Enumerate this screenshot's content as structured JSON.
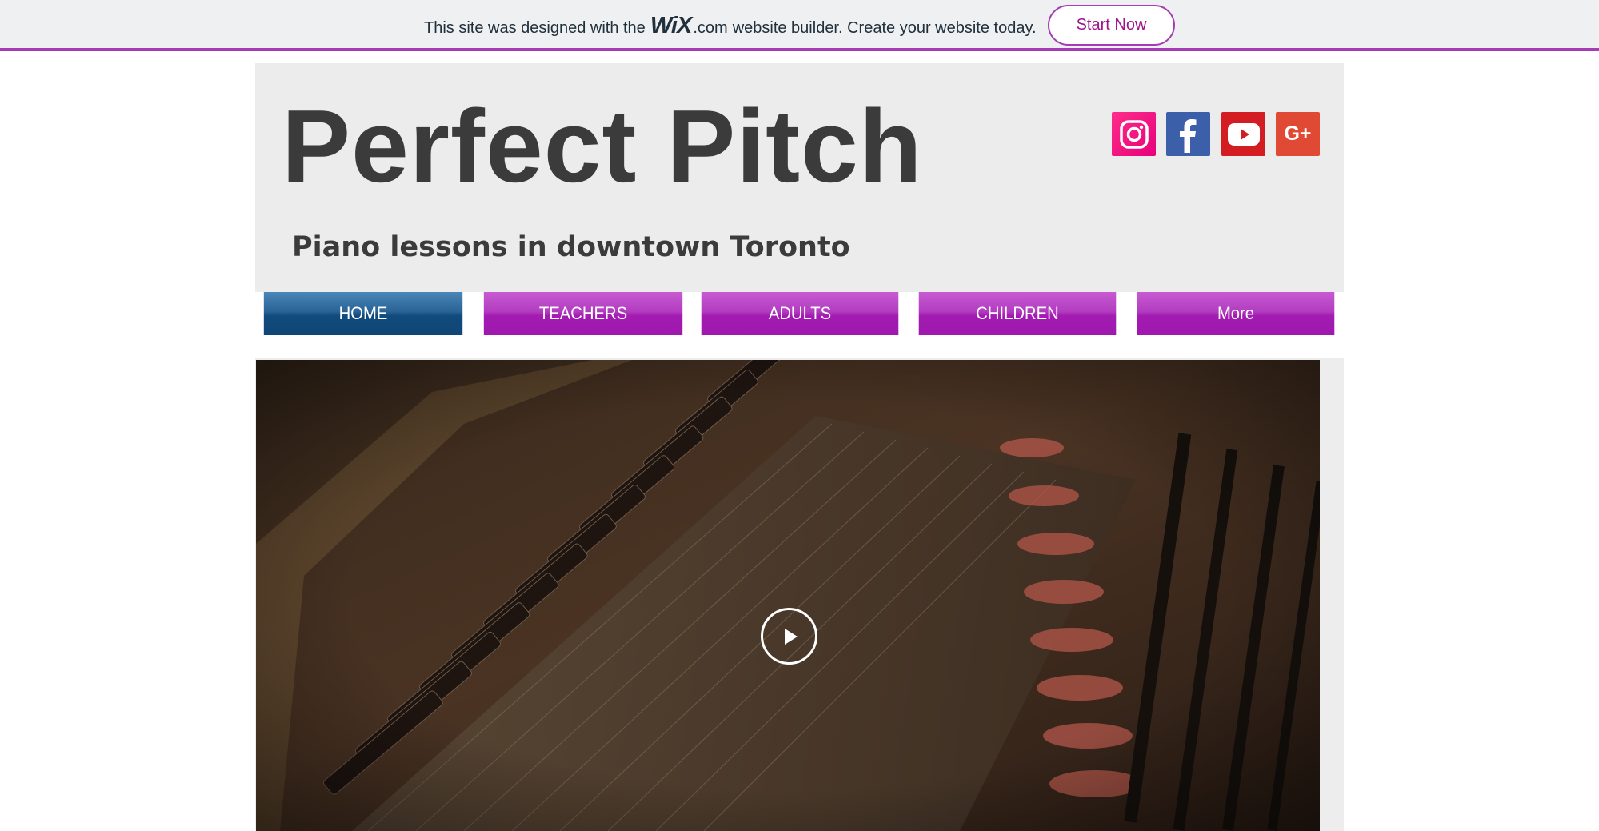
{
  "banner": {
    "text_before": "This site was designed with the",
    "logo_text": "WiX",
    "text_after": ".com",
    "text_rest": "website builder. Create your website today.",
    "cta_label": "Start Now",
    "accent_color": "#a43cb3"
  },
  "header": {
    "title": "Perfect Pitch",
    "tagline": "Piano lessons in downtown Toronto"
  },
  "social": [
    {
      "name": "instagram",
      "icon": "instagram-icon",
      "color": "#f5157c"
    },
    {
      "name": "facebook",
      "icon": "facebook-icon",
      "color": "#3b5fa8"
    },
    {
      "name": "youtube",
      "icon": "youtube-icon",
      "color": "#d31d23"
    },
    {
      "name": "google-plus",
      "icon": "google-plus-icon",
      "label": "G+",
      "color": "#e04a35"
    }
  ],
  "nav": {
    "items": [
      {
        "label": "HOME",
        "active": true
      },
      {
        "label": "TEACHERS",
        "active": false
      },
      {
        "label": "ADULTS",
        "active": false
      },
      {
        "label": "CHILDREN",
        "active": false
      },
      {
        "label": "More",
        "active": false
      }
    ],
    "active_color": "#1a5a8f",
    "item_color": "#a81fb6"
  },
  "video": {
    "play_icon": "play-icon"
  }
}
